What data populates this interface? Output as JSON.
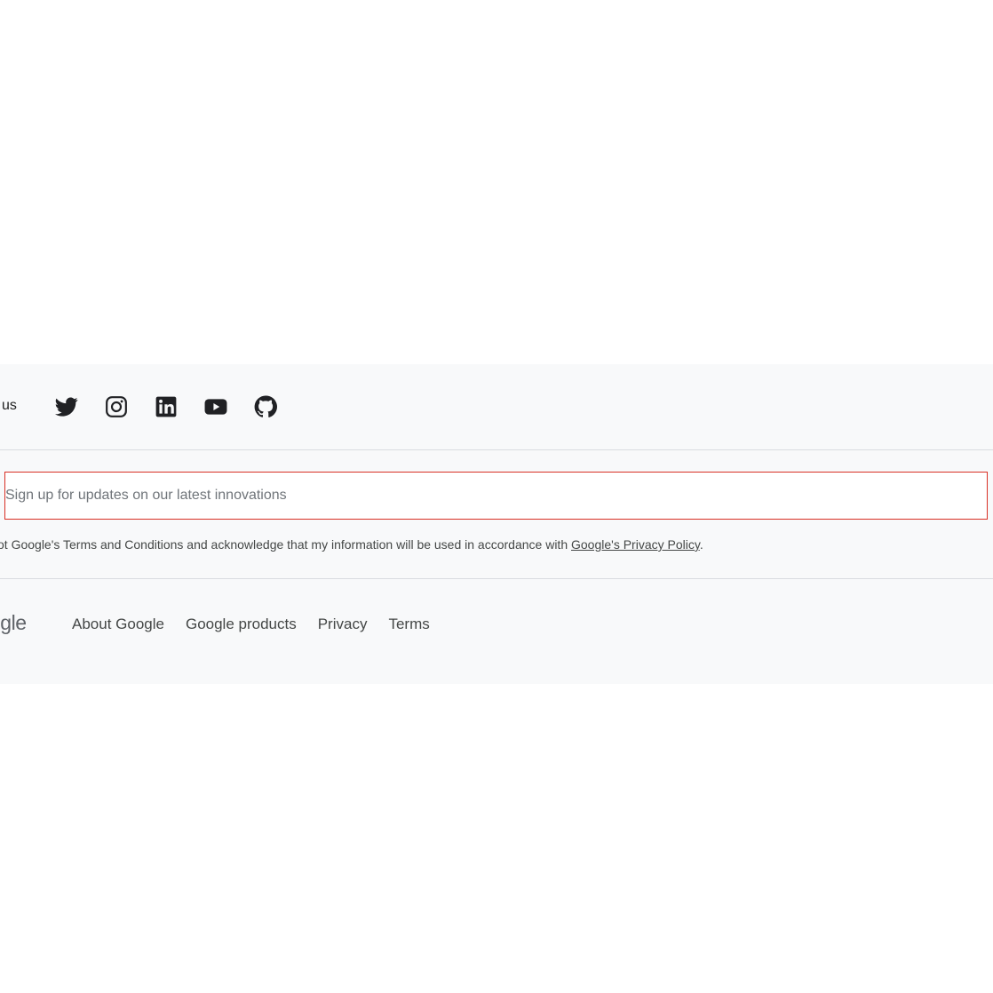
{
  "follow": {
    "label": "w us",
    "icons": [
      "twitter-icon",
      "instagram-icon",
      "linkedin-icon",
      "youtube-icon",
      "github-icon"
    ]
  },
  "signup": {
    "placeholder": "Sign up for updates on our latest innovations",
    "value": "",
    "consent_text": "ot Google's Terms and Conditions and acknowledge that my information will be used in accordance with ",
    "consent_link": "Google's Privacy Policy",
    "consent_end": "."
  },
  "bottom": {
    "logo": "ogle",
    "links": [
      "About Google",
      "Google products",
      "Privacy",
      "Terms"
    ]
  },
  "colors": {
    "footer_bg": "#f8f9fa",
    "input_border": "#d93025",
    "icon": "#202124"
  }
}
